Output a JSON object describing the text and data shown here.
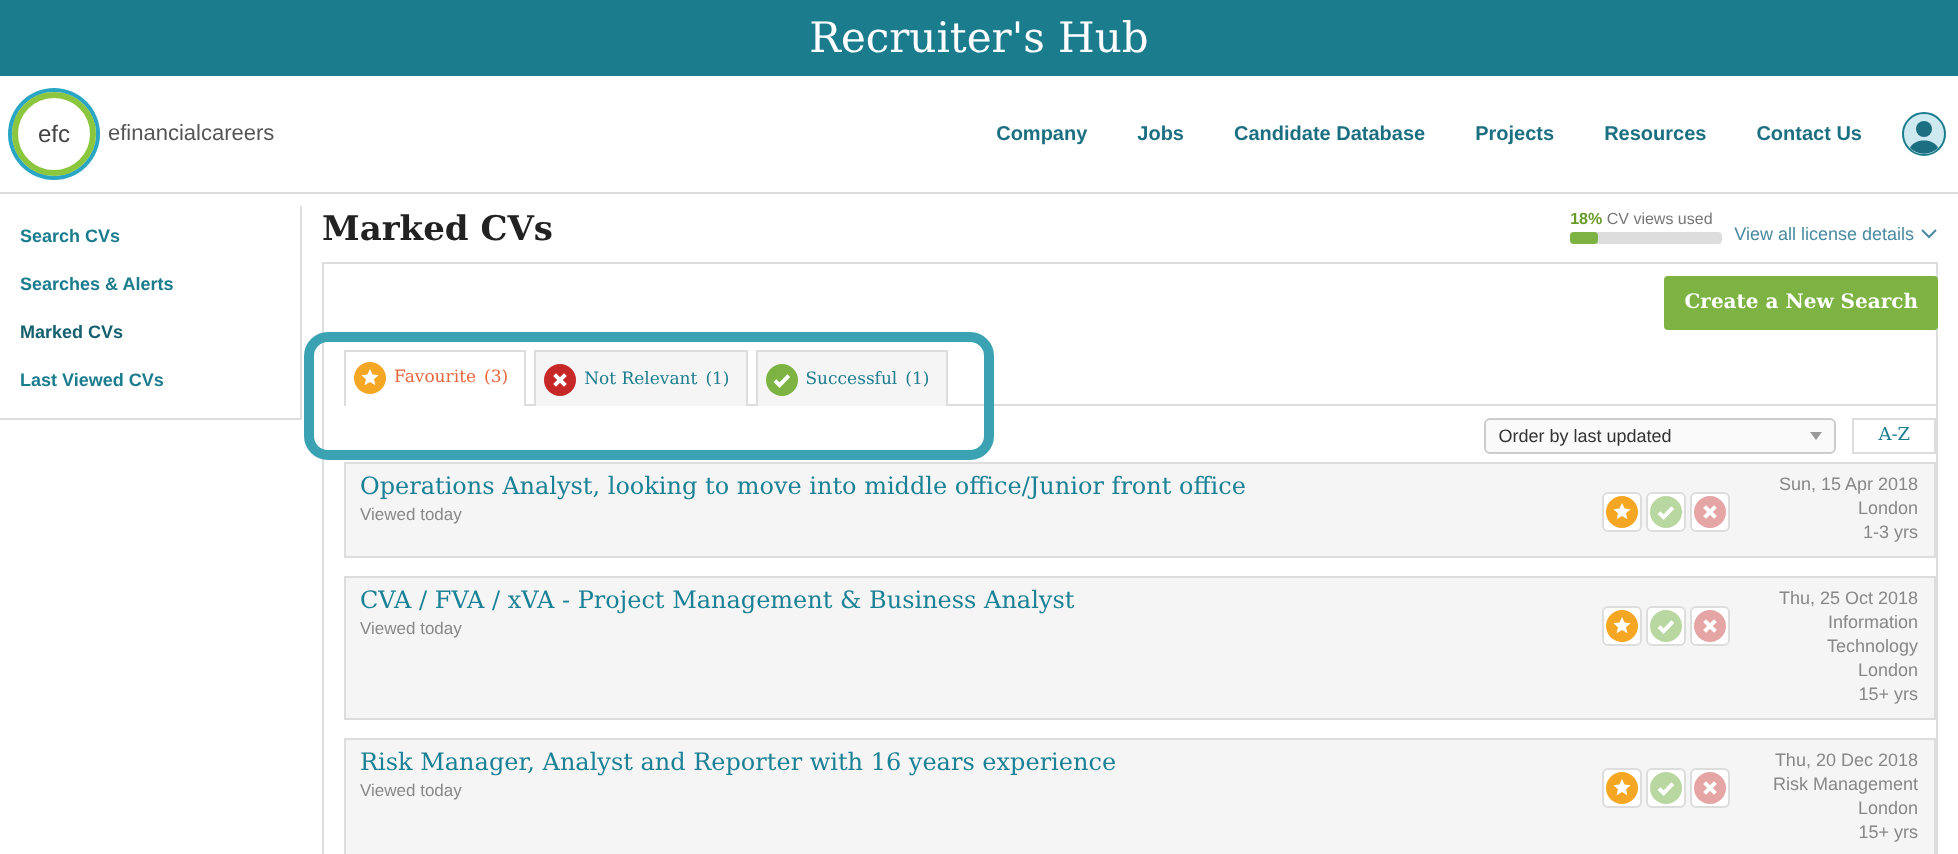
{
  "banner": {
    "title": "Recruiter's Hub"
  },
  "logo": {
    "mark": "efc",
    "wordmark": "efinancialcareers"
  },
  "nav": [
    "Company",
    "Jobs",
    "Candidate Database",
    "Projects",
    "Resources",
    "Contact Us"
  ],
  "sidebar": {
    "items": [
      {
        "label": "Search CVs",
        "selected": false
      },
      {
        "label": "Searches & Alerts",
        "selected": false
      },
      {
        "label": "Marked CVs",
        "selected": true
      },
      {
        "label": "Last Viewed CVs",
        "selected": false
      }
    ]
  },
  "page": {
    "title": "Marked CVs"
  },
  "license": {
    "percent": "18%",
    "label": "CV views used",
    "level": 0.18,
    "link": "View all license details"
  },
  "create_button": "Create a New Search",
  "tabs": [
    {
      "kind": "star",
      "label": "Favourite",
      "count": "(3)",
      "selected": true
    },
    {
      "kind": "cross",
      "label": "Not Relevant",
      "count": "(1)",
      "selected": false
    },
    {
      "kind": "check",
      "label": "Successful",
      "count": "(1)",
      "selected": false
    }
  ],
  "sort": {
    "value": "Order by last updated",
    "az": "A-Z"
  },
  "rows": [
    {
      "title": "Operations Analyst, looking to move into middle office/Junior front office",
      "viewed": "Viewed today",
      "favourite": true,
      "successful": false,
      "not_relevant": false,
      "details": [
        "Sun, 15 Apr 2018",
        "London",
        "1-3 yrs"
      ]
    },
    {
      "title": "CVA / FVA / xVA - Project Management & Business Analyst",
      "viewed": "Viewed today",
      "favourite": true,
      "successful": false,
      "not_relevant": false,
      "details": [
        "Thu, 25 Oct 2018",
        "Information",
        "Technology",
        "London",
        "15+ yrs"
      ]
    },
    {
      "title": "Risk Manager, Analyst and Reporter with 16 years experience",
      "viewed": "Viewed today",
      "favourite": true,
      "successful": false,
      "not_relevant": false,
      "details": [
        "Thu, 20 Dec 2018",
        "Risk Management",
        "London",
        "15+ yrs"
      ]
    }
  ]
}
